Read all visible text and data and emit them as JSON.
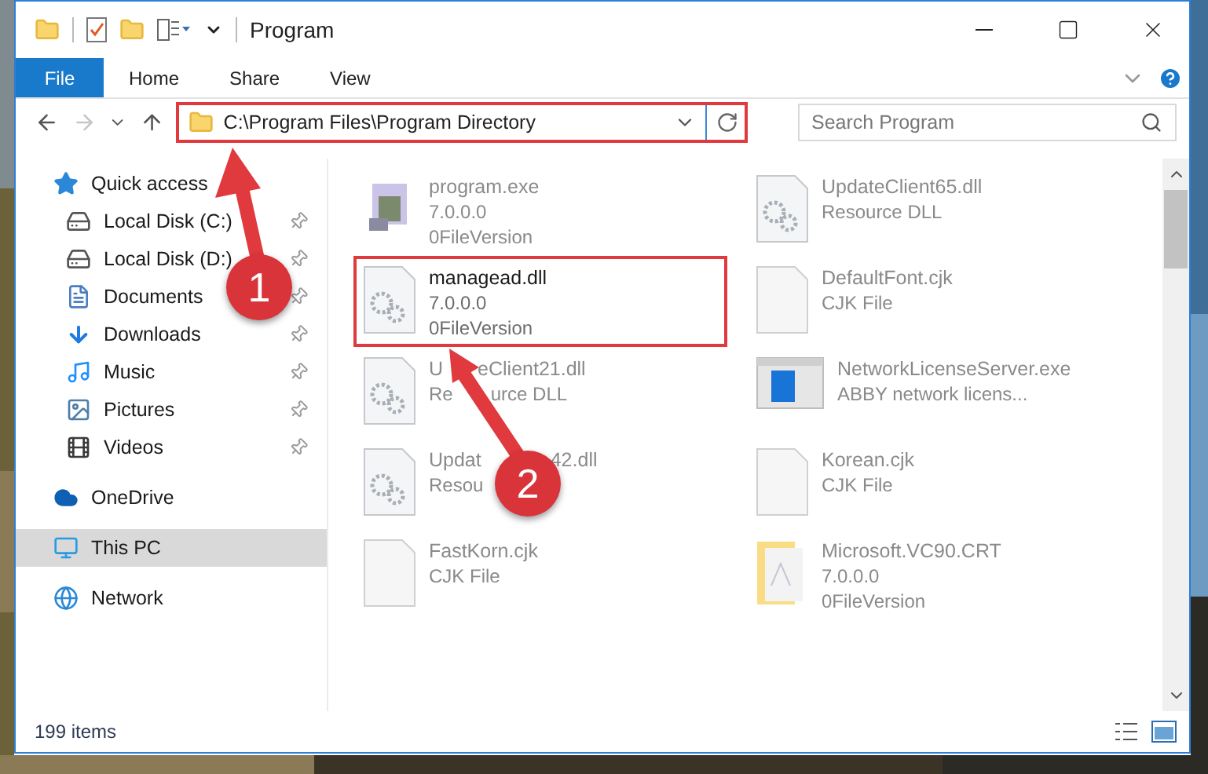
{
  "window": {
    "title": "Program"
  },
  "ribbon": {
    "tabs": [
      {
        "label": "File",
        "selected": true
      },
      {
        "label": "Home",
        "selected": false
      },
      {
        "label": "Share",
        "selected": false
      },
      {
        "label": "View",
        "selected": false
      }
    ]
  },
  "address_bar": {
    "path": "C:\\Program Files\\Program Directory",
    "highlighted": true
  },
  "search": {
    "placeholder": "Search Program"
  },
  "sidebar": {
    "items": [
      {
        "label": "Quick access",
        "kind": "star",
        "selected": false,
        "children": [
          {
            "label": "Local Disk (C:)",
            "kind": "drive",
            "pinned": true,
            "selected": false
          },
          {
            "label": "Local Disk (D:)",
            "kind": "drive",
            "pinned": true,
            "selected": false
          },
          {
            "label": "Documents",
            "kind": "document",
            "pinned": true,
            "selected": false
          },
          {
            "label": "Downloads",
            "kind": "download",
            "pinned": true,
            "selected": false
          },
          {
            "label": "Music",
            "kind": "music",
            "pinned": true,
            "selected": false
          },
          {
            "label": "Pictures",
            "kind": "pictures",
            "pinned": true,
            "selected": false
          },
          {
            "label": "Videos",
            "kind": "video",
            "pinned": true,
            "selected": false
          }
        ]
      },
      {
        "label": "OneDrive",
        "kind": "cloud",
        "selected": false
      },
      {
        "label": "This PC",
        "kind": "pc",
        "selected": true
      },
      {
        "label": "Network",
        "kind": "network",
        "selected": false
      }
    ]
  },
  "files": [
    {
      "name": [
        "program.exe"
      ],
      "lines": [
        [
          "7.0.0.0"
        ],
        [
          "0FileVersion"
        ]
      ],
      "kind": "exe",
      "highlighted": false
    },
    {
      "name": [
        "UpdateClient65.dll"
      ],
      "lines": [
        [
          "Resource DLL"
        ]
      ],
      "kind": "dll",
      "highlighted": false
    },
    {
      "name": [
        "managead.dll"
      ],
      "lines": [
        [
          "7.0.0.0"
        ],
        [
          "0FileVersion"
        ]
      ],
      "kind": "dll",
      "highlighted": true
    },
    {
      "name": [
        "DefaultFont.cjk"
      ],
      "lines": [
        [
          "CJK File"
        ]
      ],
      "kind": "file",
      "highlighted": false
    },
    {
      "name": [
        "U",
        "eClient21.dll"
      ],
      "lines": [
        [
          "Re",
          "urce DLL"
        ]
      ],
      "kind": "dll",
      "highlighted": false
    },
    {
      "name": [
        "NetworkLicenseServer.exe"
      ],
      "lines": [
        [
          "ABBY network licens..."
        ]
      ],
      "kind": "window",
      "highlighted": false
    },
    {
      "name": [
        "Updat",
        "42.dll"
      ],
      "lines": [
        [
          "Resou"
        ]
      ],
      "kind": "dll",
      "highlighted": false
    },
    {
      "name": [
        "Korean.cjk"
      ],
      "lines": [
        [
          "CJK File"
        ]
      ],
      "kind": "file",
      "highlighted": false
    },
    {
      "name": [
        "FastKorn.cjk"
      ],
      "lines": [
        [
          "CJK File"
        ]
      ],
      "kind": "file",
      "highlighted": false
    },
    {
      "name": [
        "Microsoft.VC90.CRT"
      ],
      "lines": [
        [
          "7.0.0.0"
        ],
        [
          "0FileVersion"
        ]
      ],
      "kind": "folder",
      "highlighted": false
    }
  ],
  "status_bar": {
    "item_count": "199 items"
  },
  "callouts": [
    {
      "number": "1"
    },
    {
      "number": "2"
    }
  ]
}
